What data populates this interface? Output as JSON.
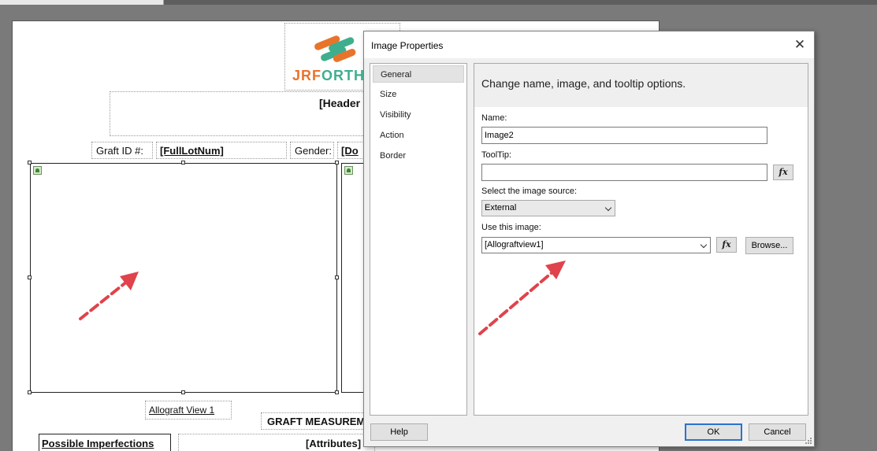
{
  "report": {
    "logo_text": "JRFORTH",
    "header_placeholder": "[Header",
    "graft_id_label": "Graft ID #:",
    "graft_id_value": "[FullLotNum]",
    "gender_label": "Gender:",
    "gender_value": "[Do",
    "image_caption": "Allograft View 1",
    "graft_measurement": "GRAFT MEASUREM",
    "possible_imperfections": "Possible Imperfections",
    "attributes": "[Attributes]"
  },
  "dialog": {
    "title": "Image Properties",
    "close_glyph": "✕",
    "nav_items": [
      "General",
      "Size",
      "Visibility",
      "Action",
      "Border"
    ],
    "selected_nav": "General",
    "header_text": "Change name, image, and tooltip options.",
    "name_label": "Name:",
    "name_value": "Image2",
    "tooltip_label": "ToolTip:",
    "tooltip_value": "",
    "fx_label": "fx",
    "source_label": "Select the image source:",
    "source_value": "External",
    "use_image_label": "Use this image:",
    "use_image_value": "[Allograftview1]",
    "browse_label": "Browse...",
    "help_label": "Help",
    "ok_label": "OK",
    "cancel_label": "Cancel"
  },
  "colors": {
    "arrow": "#e0434b",
    "default_button_border": "#2a73cc",
    "logo_orange": "#e8742c",
    "logo_green": "#3fae8f"
  }
}
